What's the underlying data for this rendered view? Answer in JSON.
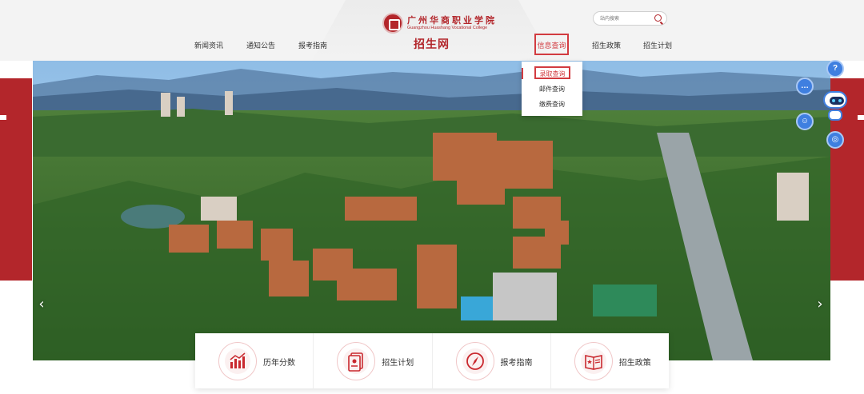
{
  "header": {
    "school_name_cn": "广州华商职业学院",
    "school_name_en": "Guangzhou Huashang Vocational College",
    "site_title": "招生网",
    "search": {
      "placeholder": "站内搜索"
    },
    "nav": [
      {
        "label": "新闻资讯"
      },
      {
        "label": "通知公告"
      },
      {
        "label": "报考指南"
      },
      {
        "label": "信息查询",
        "active": true
      },
      {
        "label": "招生政策"
      },
      {
        "label": "招生计划"
      }
    ]
  },
  "dropdown": {
    "items": [
      {
        "label": "录取查询",
        "active": true
      },
      {
        "label": "邮件查询"
      },
      {
        "label": "缴费查询"
      }
    ]
  },
  "hero": {
    "prev_icon": "chevron-left-icon",
    "next_icon": "chevron-right-icon"
  },
  "quick_links": [
    {
      "label": "历年分数",
      "icon": "bar-chart-icon"
    },
    {
      "label": "招生计划",
      "icon": "document-icon"
    },
    {
      "label": "报考指南",
      "icon": "compass-icon"
    },
    {
      "label": "招生政策",
      "icon": "policy-book-icon"
    }
  ],
  "colors": {
    "brand_red": "#b3262b",
    "accent_red": "#d23b40",
    "tool_blue": "#3f7fe0"
  }
}
